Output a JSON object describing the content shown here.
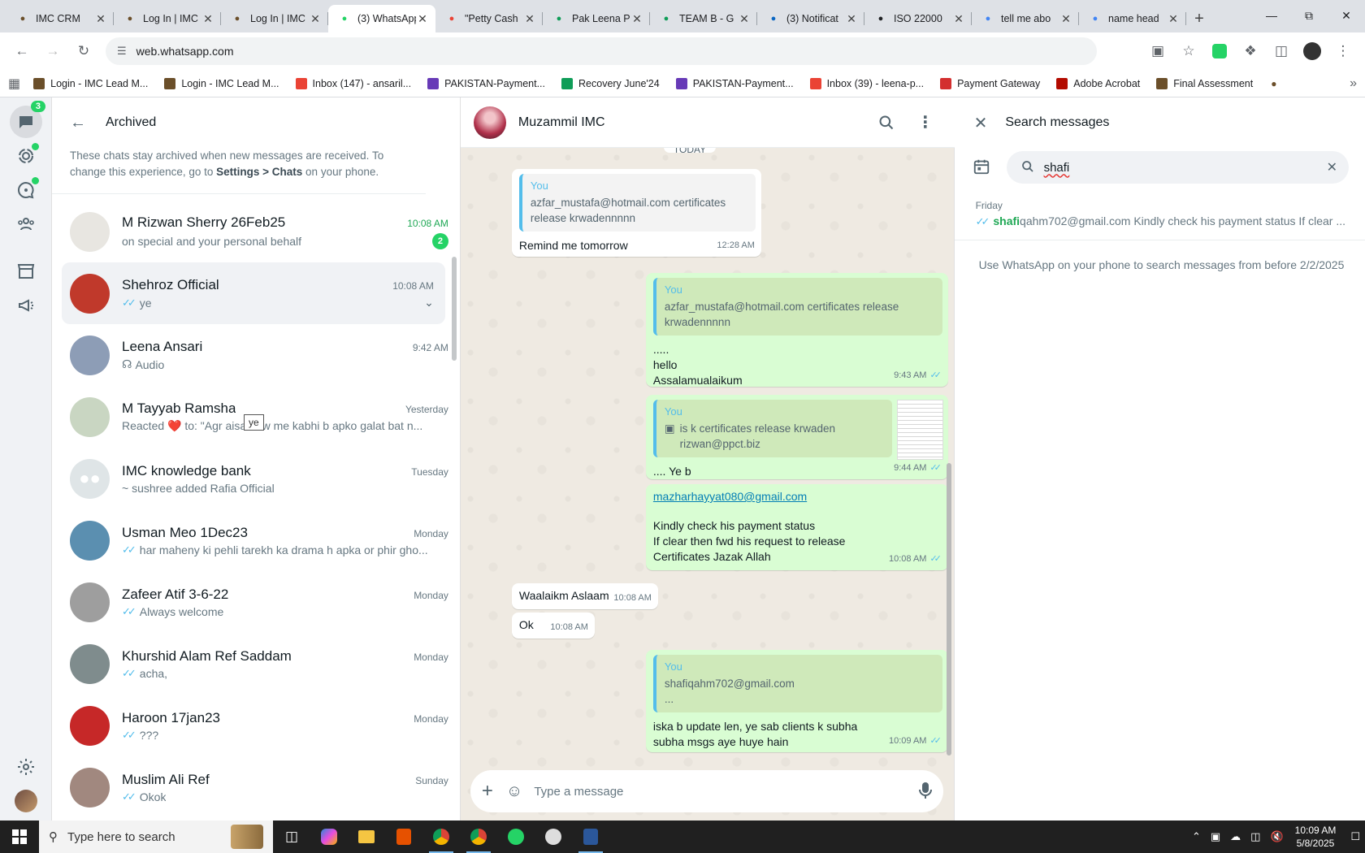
{
  "browser": {
    "tabs": [
      {
        "title": "IMC CRM",
        "favicon": "imc-icon",
        "color": "#6b4f2a"
      },
      {
        "title": "Log In | IMC",
        "favicon": "imc-icon",
        "color": "#6b4f2a"
      },
      {
        "title": "Log In | IMC",
        "favicon": "imc-icon",
        "color": "#6b4f2a"
      },
      {
        "title": "(3) WhatsApp",
        "favicon": "whatsapp-icon",
        "color": "#25d366"
      },
      {
        "title": "\"Petty Cash",
        "favicon": "gmail-icon",
        "color": "#ea4335"
      },
      {
        "title": "Pak Leena P",
        "favicon": "sheets-icon",
        "color": "#0f9d58"
      },
      {
        "title": "TEAM B - G",
        "favicon": "sheets-icon",
        "color": "#0f9d58"
      },
      {
        "title": "(3) Notificat",
        "favicon": "linkedin-icon",
        "color": "#0a66c2"
      },
      {
        "title": "ISO 22000",
        "favicon": "openai-icon",
        "color": "#202124"
      },
      {
        "title": "tell me abo",
        "favicon": "google-icon",
        "color": "#4285f4"
      },
      {
        "title": "name head",
        "favicon": "google-icon",
        "color": "#4285f4"
      }
    ],
    "url": "web.whatsapp.com",
    "bookmarks": [
      {
        "label": "Login - IMC Lead M...",
        "icon": "imc-icon",
        "color": "#6b4f2a"
      },
      {
        "label": "Login - IMC Lead M...",
        "icon": "imc-icon",
        "color": "#6b4f2a"
      },
      {
        "label": "Inbox (147) - ansaril...",
        "icon": "gmail-icon",
        "color": "#ea4335"
      },
      {
        "label": "PAKISTAN-Payment...",
        "icon": "forms-icon",
        "color": "#673ab7"
      },
      {
        "label": "Recovery June'24",
        "icon": "sheets-icon",
        "color": "#0f9d58"
      },
      {
        "label": "PAKISTAN-Payment...",
        "icon": "forms-icon",
        "color": "#673ab7"
      },
      {
        "label": "Inbox (39) - leena-p...",
        "icon": "gmail-icon",
        "color": "#ea4335"
      },
      {
        "label": "Payment Gateway",
        "icon": "gateway-icon",
        "color": "#d32f2f"
      },
      {
        "label": "Adobe Acrobat",
        "icon": "acrobat-icon",
        "color": "#b30b00"
      },
      {
        "label": "Final Assessment",
        "icon": "imc-icon",
        "color": "#6b4f2a"
      }
    ]
  },
  "nav": {
    "chats_badge": "3"
  },
  "archived": {
    "title": "Archived",
    "note_prefix": "These chats stay archived when new messages are received. To change this experience, go to ",
    "note_settings": "Settings",
    "note_gt": " > ",
    "note_chats": "Chats",
    "note_suffix": " on your phone.",
    "chats": [
      {
        "name": "M Rizwan Sherry 26Feb25",
        "time": "10:08 AM",
        "preview": "on special and your personal behalf",
        "unread": "2",
        "tick": false,
        "avatar_color": "#e8e6e1"
      },
      {
        "name": "Shehroz Official",
        "time": "10:08 AM",
        "preview": "ye",
        "unread": "",
        "tick": true,
        "avatar_color": "#c0392b"
      },
      {
        "name": "Leena Ansari",
        "time": "9:42 AM",
        "preview": "Audio",
        "unread": "",
        "tick": false,
        "avatar_color": "#8d9db6"
      },
      {
        "name": "M Tayyab Ramsha",
        "time": "Yesterday",
        "preview": "Reacted ❤️ to: \"Agr aisa h tw me kabhi b apko galat bat n...",
        "unread": "",
        "tick": false,
        "avatar_color": "#c9d6c2"
      },
      {
        "name": "IMC knowledge bank",
        "time": "Tuesday",
        "preview": "~ sushree added Rafia Official",
        "unread": "",
        "tick": false,
        "avatar_color": "#dfe5e7"
      },
      {
        "name": "Usman Meo 1Dec23",
        "time": "Monday",
        "preview": "har maheny ki pehli tarekh ka drama h apka or phir gho...",
        "unread": "",
        "tick": true,
        "avatar_color": "#5b8fb0"
      },
      {
        "name": "Zafeer Atif 3-6-22",
        "time": "Monday",
        "preview": "Always welcome",
        "unread": "",
        "tick": true,
        "avatar_color": "#9e9e9e"
      },
      {
        "name": "Khurshid Alam Ref Saddam",
        "time": "Monday",
        "preview": "acha,",
        "unread": "",
        "tick": true,
        "avatar_color": "#7f8c8d"
      },
      {
        "name": "Haroon 17jan23",
        "time": "Monday",
        "preview": "???",
        "unread": "",
        "tick": true,
        "avatar_color": "#c62828"
      },
      {
        "name": "Muslim Ali Ref",
        "time": "Sunday",
        "preview": "Okok",
        "unread": "",
        "tick": true,
        "avatar_color": "#a1887f"
      }
    ],
    "tooltip": "ye"
  },
  "conversation": {
    "contact": "Muzammil IMC",
    "day_label": "TODAY",
    "messages": {
      "m1_quote_name": "You",
      "m1_quote_text": "azfar_mustafa@hotmail.com certificates release krwadennnnn",
      "m1_text": "Remind me tomorrow",
      "m1_time": "12:28 AM",
      "m2_quote_name": "You",
      "m2_quote_text": "azfar_mustafa@hotmail.com certificates release krwadennnnn",
      "m2_line1": ".....",
      "m2_line2": "hello",
      "m2_line3": "Assalamualaikum",
      "m2_time": "9:43 AM",
      "m3_quote_name": "You",
      "m3_quote_text": "is k certificates release krwaden rizwan@ppct.biz",
      "m3_text": ".... Ye b",
      "m3_time": "9:44 AM",
      "m4_link": "mazharhayyat080@gmail.com",
      "m4_line1": "Kindly check his payment status",
      "m4_line2": "If clear then fwd his request to release",
      "m4_line3": "Certificates Jazak Allah",
      "m4_time": "10:08 AM",
      "m5_text": "Waalaikm Aslaam",
      "m5_time": "10:08 AM",
      "m6_text": "Ok",
      "m6_time": "10:08 AM",
      "m7_quote_name": "You",
      "m7_quote_text1": "shafiqahm702@gmail.com",
      "m7_quote_text2": "...",
      "m7_line1": "iska b update len, ye sab clients k subha",
      "m7_line2": "subha msgs aye huye hain",
      "m7_time": "10:09 AM"
    },
    "composer_placeholder": "Type a message"
  },
  "search": {
    "title": "Search messages",
    "query": "shafi",
    "result_date": "Friday",
    "result_highlight": "shafi",
    "result_rest": "qahm702@gmail.com Kindly check his payment status  If clear ...",
    "footer": "Use WhatsApp on your phone to search messages from before 2/2/2025"
  },
  "taskbar": {
    "search_placeholder": "Type here to search",
    "time": "10:09 AM",
    "date": "5/8/2025"
  }
}
